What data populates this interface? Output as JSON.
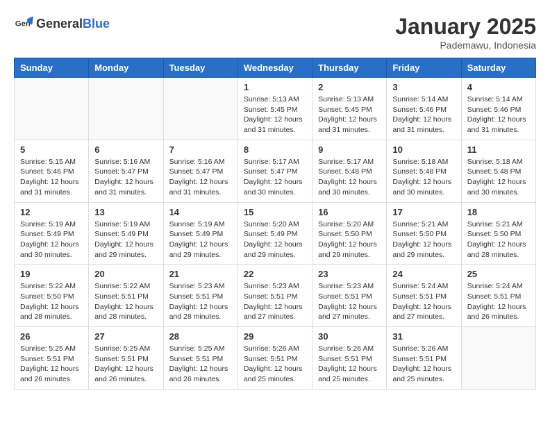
{
  "header": {
    "logo_general": "General",
    "logo_blue": "Blue",
    "month": "January 2025",
    "location": "Pademawu, Indonesia"
  },
  "weekdays": [
    "Sunday",
    "Monday",
    "Tuesday",
    "Wednesday",
    "Thursday",
    "Friday",
    "Saturday"
  ],
  "weeks": [
    [
      {
        "day": "",
        "info": ""
      },
      {
        "day": "",
        "info": ""
      },
      {
        "day": "",
        "info": ""
      },
      {
        "day": "1",
        "info": "Sunrise: 5:13 AM\nSunset: 5:45 PM\nDaylight: 12 hours\nand 31 minutes."
      },
      {
        "day": "2",
        "info": "Sunrise: 5:13 AM\nSunset: 5:45 PM\nDaylight: 12 hours\nand 31 minutes."
      },
      {
        "day": "3",
        "info": "Sunrise: 5:14 AM\nSunset: 5:46 PM\nDaylight: 12 hours\nand 31 minutes."
      },
      {
        "day": "4",
        "info": "Sunrise: 5:14 AM\nSunset: 5:46 PM\nDaylight: 12 hours\nand 31 minutes."
      }
    ],
    [
      {
        "day": "5",
        "info": "Sunrise: 5:15 AM\nSunset: 5:46 PM\nDaylight: 12 hours\nand 31 minutes."
      },
      {
        "day": "6",
        "info": "Sunrise: 5:16 AM\nSunset: 5:47 PM\nDaylight: 12 hours\nand 31 minutes."
      },
      {
        "day": "7",
        "info": "Sunrise: 5:16 AM\nSunset: 5:47 PM\nDaylight: 12 hours\nand 31 minutes."
      },
      {
        "day": "8",
        "info": "Sunrise: 5:17 AM\nSunset: 5:47 PM\nDaylight: 12 hours\nand 30 minutes."
      },
      {
        "day": "9",
        "info": "Sunrise: 5:17 AM\nSunset: 5:48 PM\nDaylight: 12 hours\nand 30 minutes."
      },
      {
        "day": "10",
        "info": "Sunrise: 5:18 AM\nSunset: 5:48 PM\nDaylight: 12 hours\nand 30 minutes."
      },
      {
        "day": "11",
        "info": "Sunrise: 5:18 AM\nSunset: 5:48 PM\nDaylight: 12 hours\nand 30 minutes."
      }
    ],
    [
      {
        "day": "12",
        "info": "Sunrise: 5:19 AM\nSunset: 5:49 PM\nDaylight: 12 hours\nand 30 minutes."
      },
      {
        "day": "13",
        "info": "Sunrise: 5:19 AM\nSunset: 5:49 PM\nDaylight: 12 hours\nand 29 minutes."
      },
      {
        "day": "14",
        "info": "Sunrise: 5:19 AM\nSunset: 5:49 PM\nDaylight: 12 hours\nand 29 minutes."
      },
      {
        "day": "15",
        "info": "Sunrise: 5:20 AM\nSunset: 5:49 PM\nDaylight: 12 hours\nand 29 minutes."
      },
      {
        "day": "16",
        "info": "Sunrise: 5:20 AM\nSunset: 5:50 PM\nDaylight: 12 hours\nand 29 minutes."
      },
      {
        "day": "17",
        "info": "Sunrise: 5:21 AM\nSunset: 5:50 PM\nDaylight: 12 hours\nand 29 minutes."
      },
      {
        "day": "18",
        "info": "Sunrise: 5:21 AM\nSunset: 5:50 PM\nDaylight: 12 hours\nand 28 minutes."
      }
    ],
    [
      {
        "day": "19",
        "info": "Sunrise: 5:22 AM\nSunset: 5:50 PM\nDaylight: 12 hours\nand 28 minutes."
      },
      {
        "day": "20",
        "info": "Sunrise: 5:22 AM\nSunset: 5:51 PM\nDaylight: 12 hours\nand 28 minutes."
      },
      {
        "day": "21",
        "info": "Sunrise: 5:23 AM\nSunset: 5:51 PM\nDaylight: 12 hours\nand 28 minutes."
      },
      {
        "day": "22",
        "info": "Sunrise: 5:23 AM\nSunset: 5:51 PM\nDaylight: 12 hours\nand 27 minutes."
      },
      {
        "day": "23",
        "info": "Sunrise: 5:23 AM\nSunset: 5:51 PM\nDaylight: 12 hours\nand 27 minutes."
      },
      {
        "day": "24",
        "info": "Sunrise: 5:24 AM\nSunset: 5:51 PM\nDaylight: 12 hours\nand 27 minutes."
      },
      {
        "day": "25",
        "info": "Sunrise: 5:24 AM\nSunset: 5:51 PM\nDaylight: 12 hours\nand 26 minutes."
      }
    ],
    [
      {
        "day": "26",
        "info": "Sunrise: 5:25 AM\nSunset: 5:51 PM\nDaylight: 12 hours\nand 26 minutes."
      },
      {
        "day": "27",
        "info": "Sunrise: 5:25 AM\nSunset: 5:51 PM\nDaylight: 12 hours\nand 26 minutes."
      },
      {
        "day": "28",
        "info": "Sunrise: 5:25 AM\nSunset: 5:51 PM\nDaylight: 12 hours\nand 26 minutes."
      },
      {
        "day": "29",
        "info": "Sunrise: 5:26 AM\nSunset: 5:51 PM\nDaylight: 12 hours\nand 25 minutes."
      },
      {
        "day": "30",
        "info": "Sunrise: 5:26 AM\nSunset: 5:51 PM\nDaylight: 12 hours\nand 25 minutes."
      },
      {
        "day": "31",
        "info": "Sunrise: 5:26 AM\nSunset: 5:51 PM\nDaylight: 12 hours\nand 25 minutes."
      },
      {
        "day": "",
        "info": ""
      }
    ]
  ]
}
